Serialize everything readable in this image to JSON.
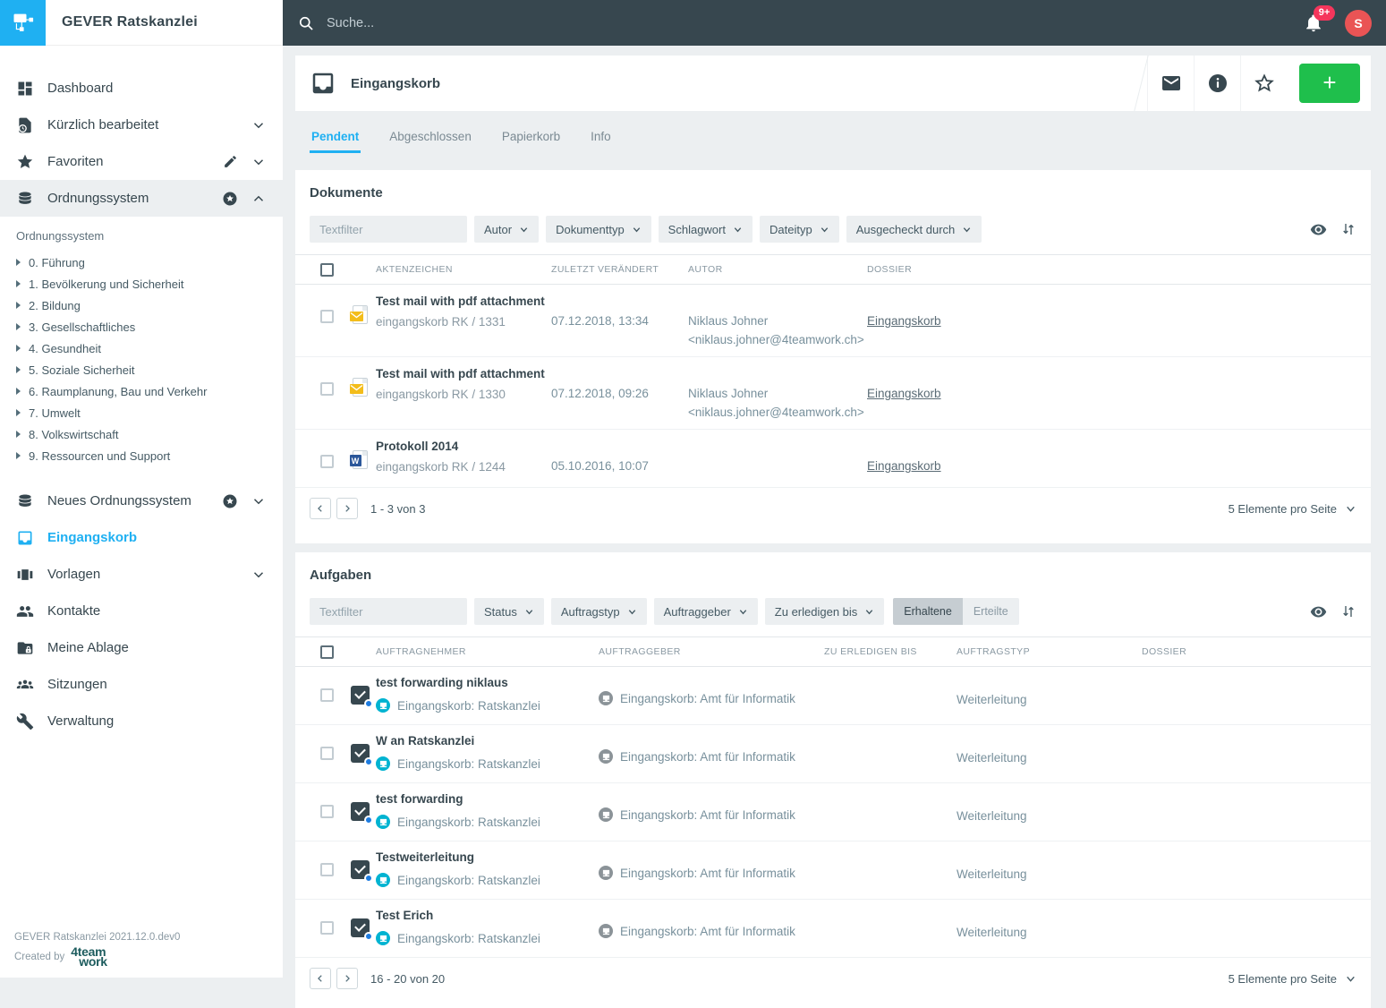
{
  "colors": {
    "accent": "#1fb0f2",
    "topbar": "#37474f",
    "add_button_green": "#1fbf4c",
    "notification_badge": "#f5365c",
    "avatar": "#ea5455",
    "responsible_circle_teal": "#00b3d1",
    "issuer_circle_gray": "#8b9398"
  },
  "app": {
    "title": "GEVER Ratskanzlei",
    "version": "GEVER Ratskanzlei 2021.12.0.dev0",
    "created_by": "Created by",
    "brand_line1": "4team",
    "brand_line2": "work"
  },
  "topbar": {
    "search_placeholder": "Suche...",
    "notification_count": "9+",
    "avatar_initial": "S"
  },
  "sidebar": {
    "items": [
      {
        "label": "Dashboard",
        "icon": "dashboard-icon"
      },
      {
        "label": "Kürzlich bearbeitet",
        "icon": "recent-document-icon"
      },
      {
        "label": "Favoriten",
        "icon": "star-icon"
      },
      {
        "label": "Ordnungssystem",
        "icon": "repository-icon"
      }
    ],
    "tree": {
      "label": "Ordnungssystem",
      "nodes": [
        "0. Führung",
        "1. Bevölkerung und Sicherheit",
        "2. Bildung",
        "3. Gesellschaftliches",
        "4. Gesundheit",
        "5. Soziale Sicherheit",
        "6. Raumplanung, Bau und Verkehr",
        "7. Umwelt",
        "8. Volkswirtschaft",
        "9. Ressourcen und Support"
      ]
    },
    "items_secondary": [
      {
        "label": "Neues Ordnungssystem",
        "icon": "repository-icon"
      },
      {
        "label": "Eingangskorb",
        "icon": "inbox-icon"
      },
      {
        "label": "Vorlagen",
        "icon": "templates-icon"
      },
      {
        "label": "Kontakte",
        "icon": "contacts-icon"
      },
      {
        "label": "Meine Ablage",
        "icon": "private-folder-icon"
      },
      {
        "label": "Sitzungen",
        "icon": "meetings-icon"
      },
      {
        "label": "Verwaltung",
        "icon": "wrench-icon"
      }
    ]
  },
  "header": {
    "title": "Eingangskorb",
    "add_label": "+"
  },
  "tabs": {
    "items": [
      "Pendent",
      "Abgeschlossen",
      "Papierkorb",
      "Info"
    ],
    "active": "Pendent"
  },
  "documents": {
    "title": "Dokumente",
    "textfilter_placeholder": "Textfilter",
    "filters": [
      {
        "label": "Autor"
      },
      {
        "label": "Dokumenttyp"
      },
      {
        "label": "Schlagwort"
      },
      {
        "label": "Dateityp"
      },
      {
        "label": "Ausgecheckt durch"
      }
    ],
    "columns": [
      "AKTENZEICHEN",
      "ZULETZT VERÄNDERT",
      "AUTOR",
      "DOSSIER"
    ],
    "rows": [
      {
        "icon": "mail-document-icon",
        "title": "Test mail with pdf attachment",
        "reference": "eingangskorb RK / 1331",
        "modified": "07.12.2018, 13:34",
        "author_name": "Niklaus Johner",
        "author_email": "<niklaus.johner@4teamwork.ch>",
        "dossier": "Eingangskorb"
      },
      {
        "icon": "mail-document-icon",
        "title": "Test mail with pdf attachment",
        "reference": "eingangskorb RK / 1330",
        "modified": "07.12.2018, 09:26",
        "author_name": "Niklaus Johner",
        "author_email": "<niklaus.johner@4teamwork.ch>",
        "dossier": "Eingangskorb"
      },
      {
        "icon": "word-document-icon",
        "title": "Protokoll 2014",
        "reference": "eingangskorb RK / 1244",
        "modified": "05.10.2016, 10:07",
        "dossier": "Eingangskorb"
      }
    ],
    "pagination": {
      "range": "1 - 3 von 3",
      "per_page": "5 Elemente pro Seite"
    }
  },
  "tasks": {
    "title": "Aufgaben",
    "textfilter_placeholder": "Textfilter",
    "filters": [
      {
        "label": "Status"
      },
      {
        "label": "Auftragstyp"
      },
      {
        "label": "Auftraggeber"
      },
      {
        "label": "Zu erledigen bis"
      }
    ],
    "toggle": {
      "received": "Erhaltene",
      "issued": "Erteilte"
    },
    "columns": [
      "AUFTRAGNEHMER",
      "AUFTRAGGEBER",
      "ZU ERLEDIGEN BIS",
      "AUFTRAGSTYP",
      "DOSSIER"
    ],
    "rows": [
      {
        "title": "test forwarding niklaus",
        "responsible": "Eingangskorb: Ratskanzlei",
        "issuer": "Eingangskorb: Amt für Informatik",
        "task_type": "Weiterleitung"
      },
      {
        "title": "W an Ratskanzlei",
        "responsible": "Eingangskorb: Ratskanzlei",
        "issuer": "Eingangskorb: Amt für Informatik",
        "task_type": "Weiterleitung"
      },
      {
        "title": "test forwarding",
        "responsible": "Eingangskorb: Ratskanzlei",
        "issuer": "Eingangskorb: Amt für Informatik",
        "task_type": "Weiterleitung"
      },
      {
        "title": "Testweiterleitung",
        "responsible": "Eingangskorb: Ratskanzlei",
        "issuer": "Eingangskorb: Amt für Informatik",
        "task_type": "Weiterleitung"
      },
      {
        "title": "Test Erich",
        "responsible": "Eingangskorb: Ratskanzlei",
        "issuer": "Eingangskorb: Amt für Informatik",
        "task_type": "Weiterleitung"
      }
    ],
    "pagination": {
      "range": "16 - 20 von 20",
      "per_page": "5 Elemente pro Seite"
    }
  }
}
